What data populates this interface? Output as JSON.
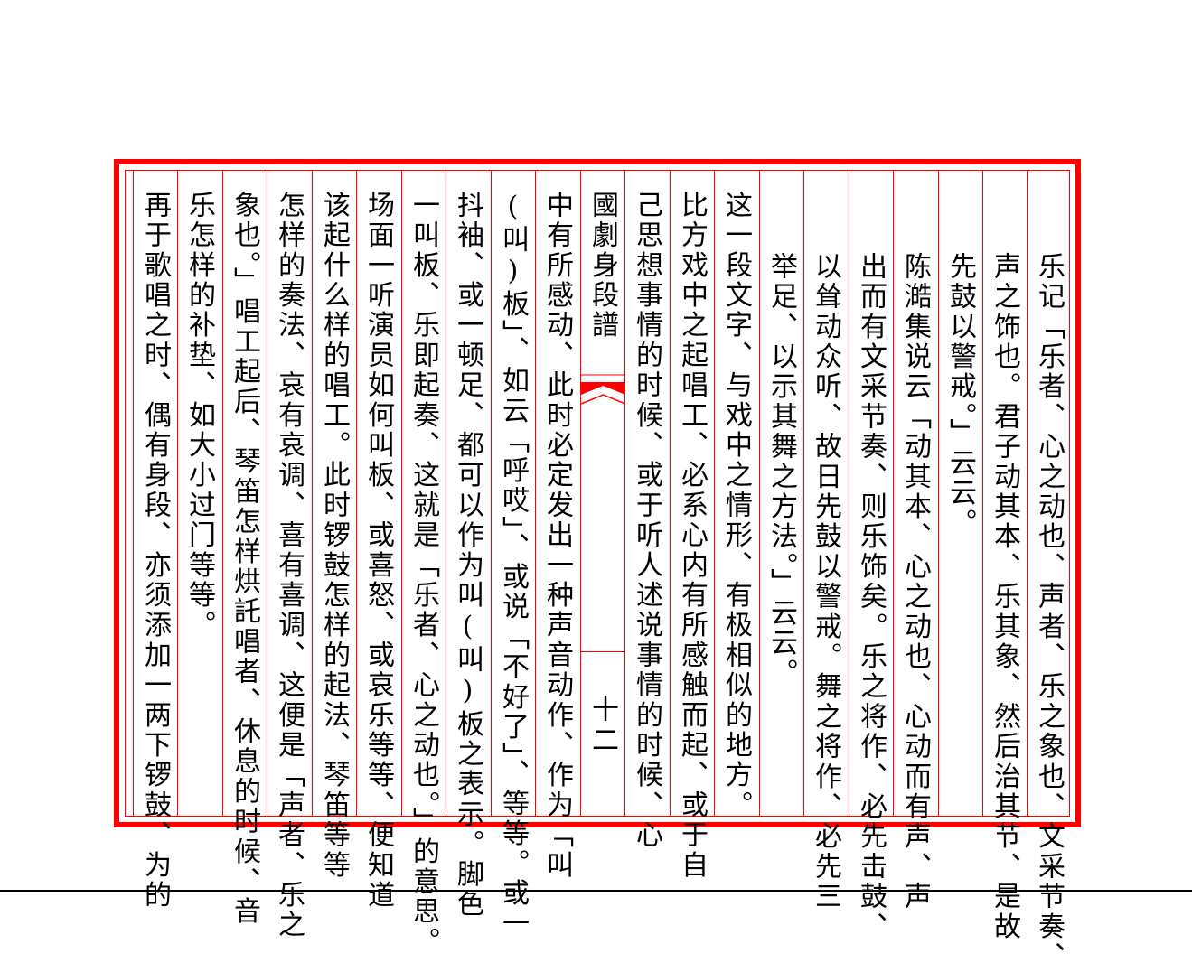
{
  "book": {
    "title": "國劇身段譜",
    "page_number": "十二"
  },
  "columns": [
    "乐记「乐者、心之动也、声者、乐之象也、文采节奏、",
    "声之饰也。君子动其本、乐其象、然后治其节、是故",
    "先鼓以警戒。」云云。",
    "陈澔集说云「动其本、心之动也、心动而有声、声",
    "出而有文采节奏、则乐饰矣。乐之将作、必先击鼓、",
    "以耸动众听、故日先鼓以警戒。舞之将作、必先三",
    "举足、以示其舞之方法。」云云。",
    "这一段文字、与戏中之情形、有极相似的地方。",
    "比方戏中之起唱工、必系心内有所感触而起、或于自",
    "己思想事情的时候、或于听人述说事情的时候、心",
    "中有所感动、此时必定发出一种声音动作、作为「叫",
    "(叫)板」、如云「呼哎」、或说「不好了」、等等。或一",
    "抖袖、或一顿足、都可以作为叫(叫)板之表示。脚色",
    "一叫板、乐即起奏、这就是「乐者、心之动也。」的意思。",
    "场面一听演员如何叫板、或喜怒、或哀乐等等、便知道",
    "该起什么样的唱工。此时锣鼓怎样的起法、琴笛等等",
    "怎样的奏法、哀有哀调、喜有喜调、这便是「声者、乐之",
    "象也。」唱工起后、琴笛怎样烘託唱者、休息的时候、音",
    "乐怎样的补垫、如大小过门等等。",
    "再于歌唱之时、偶有身段、亦须添加一两下锣鼓、为的"
  ],
  "colors": {
    "frame": "#ff0000",
    "text": "#000000",
    "background": "#ffffff"
  }
}
